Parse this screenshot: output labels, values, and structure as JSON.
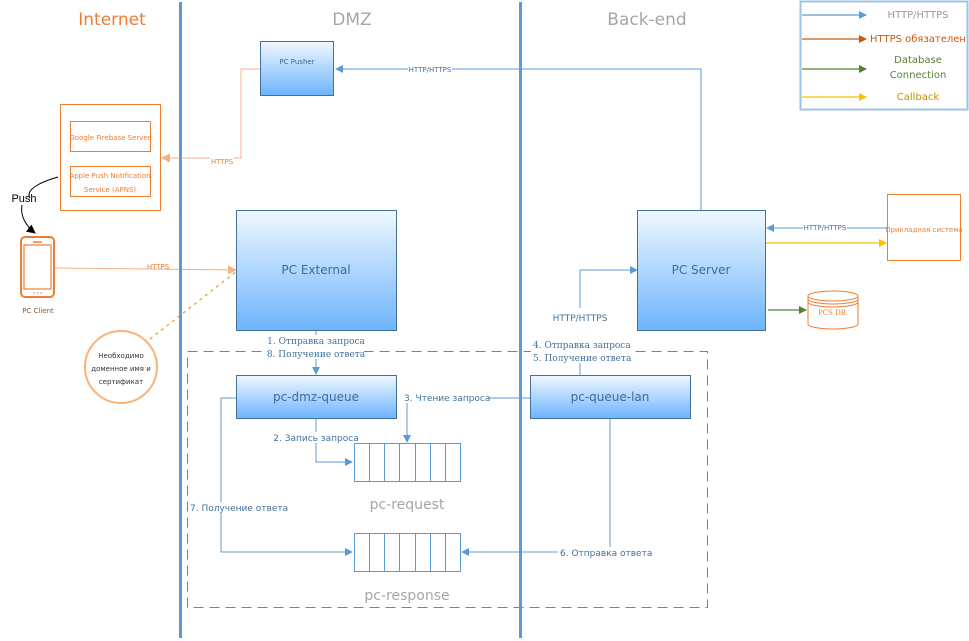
{
  "zones": {
    "internet": "Internet",
    "dmz": "DMZ",
    "backend": "Back-end"
  },
  "legend": {
    "items": [
      {
        "label_lines": [
          "HTTP/HTTPS"
        ],
        "color": "#5b9bd5",
        "text_color": "#999999"
      },
      {
        "label_lines": [
          "HTTPS обязателен"
        ],
        "color": "#c55a11",
        "text_color": "#c55a11"
      },
      {
        "label_lines": [
          "Database",
          "Connection"
        ],
        "color": "#548235",
        "text_color": "#548235"
      },
      {
        "label_lines": [
          "Callback"
        ],
        "color": "#ffc000",
        "text_color": "#bf9000"
      }
    ],
    "border_color": "#9dc3e6"
  },
  "nodes": {
    "pc_pusher": "PC Pusher",
    "push_provider_firebase": "Google Firebase Server",
    "push_provider_apns_line1": "Apple Push Notification",
    "push_provider_apns_line2": "Service (APNS)",
    "pc_client": "PC Client",
    "pc_external": "PC External",
    "pc_server": "PC Server",
    "applied_system": "Прикладная система",
    "pcs_db": "PCS DB",
    "pc_dmz_queue": "pc-dmz-queue",
    "pc_queue_lan": "pc-queue-lan",
    "pc_request": "pc-request",
    "pc_response": "pc-response",
    "note_line1": "Необходимо",
    "note_line2": "доменное имя и",
    "note_line3": "сертификат"
  },
  "connections": {
    "push": "Push",
    "pusher_to_provider": "HTTPS",
    "server_to_pusher": "HTTP/HTTPS",
    "client_to_external": "HTTPS",
    "applied_to_server": "HTTP/HTTPS",
    "lan_to_server": "HTTP/HTTPS",
    "step1": "1. Отправка запроса",
    "step8": "8. Получение ответа",
    "step2": "2. Запись запроса",
    "step3": "3. Чтение запроса",
    "step4": "4. Отправка запроса",
    "step5": "5. Получение ответа",
    "step6": "6. Отправка ответа",
    "step7": "7. Получение ответа"
  },
  "colors": {
    "zone_divider": "#5b9bd5",
    "http": "#5b9bd5",
    "https_required": "#f4b183",
    "external_border": "#ed7d31",
    "database": "#548235",
    "callback": "#ffc000",
    "box_border": "#41719c",
    "box_gradient_top": "#ddeeff",
    "box_gradient_bottom": "#6cb4fb"
  }
}
